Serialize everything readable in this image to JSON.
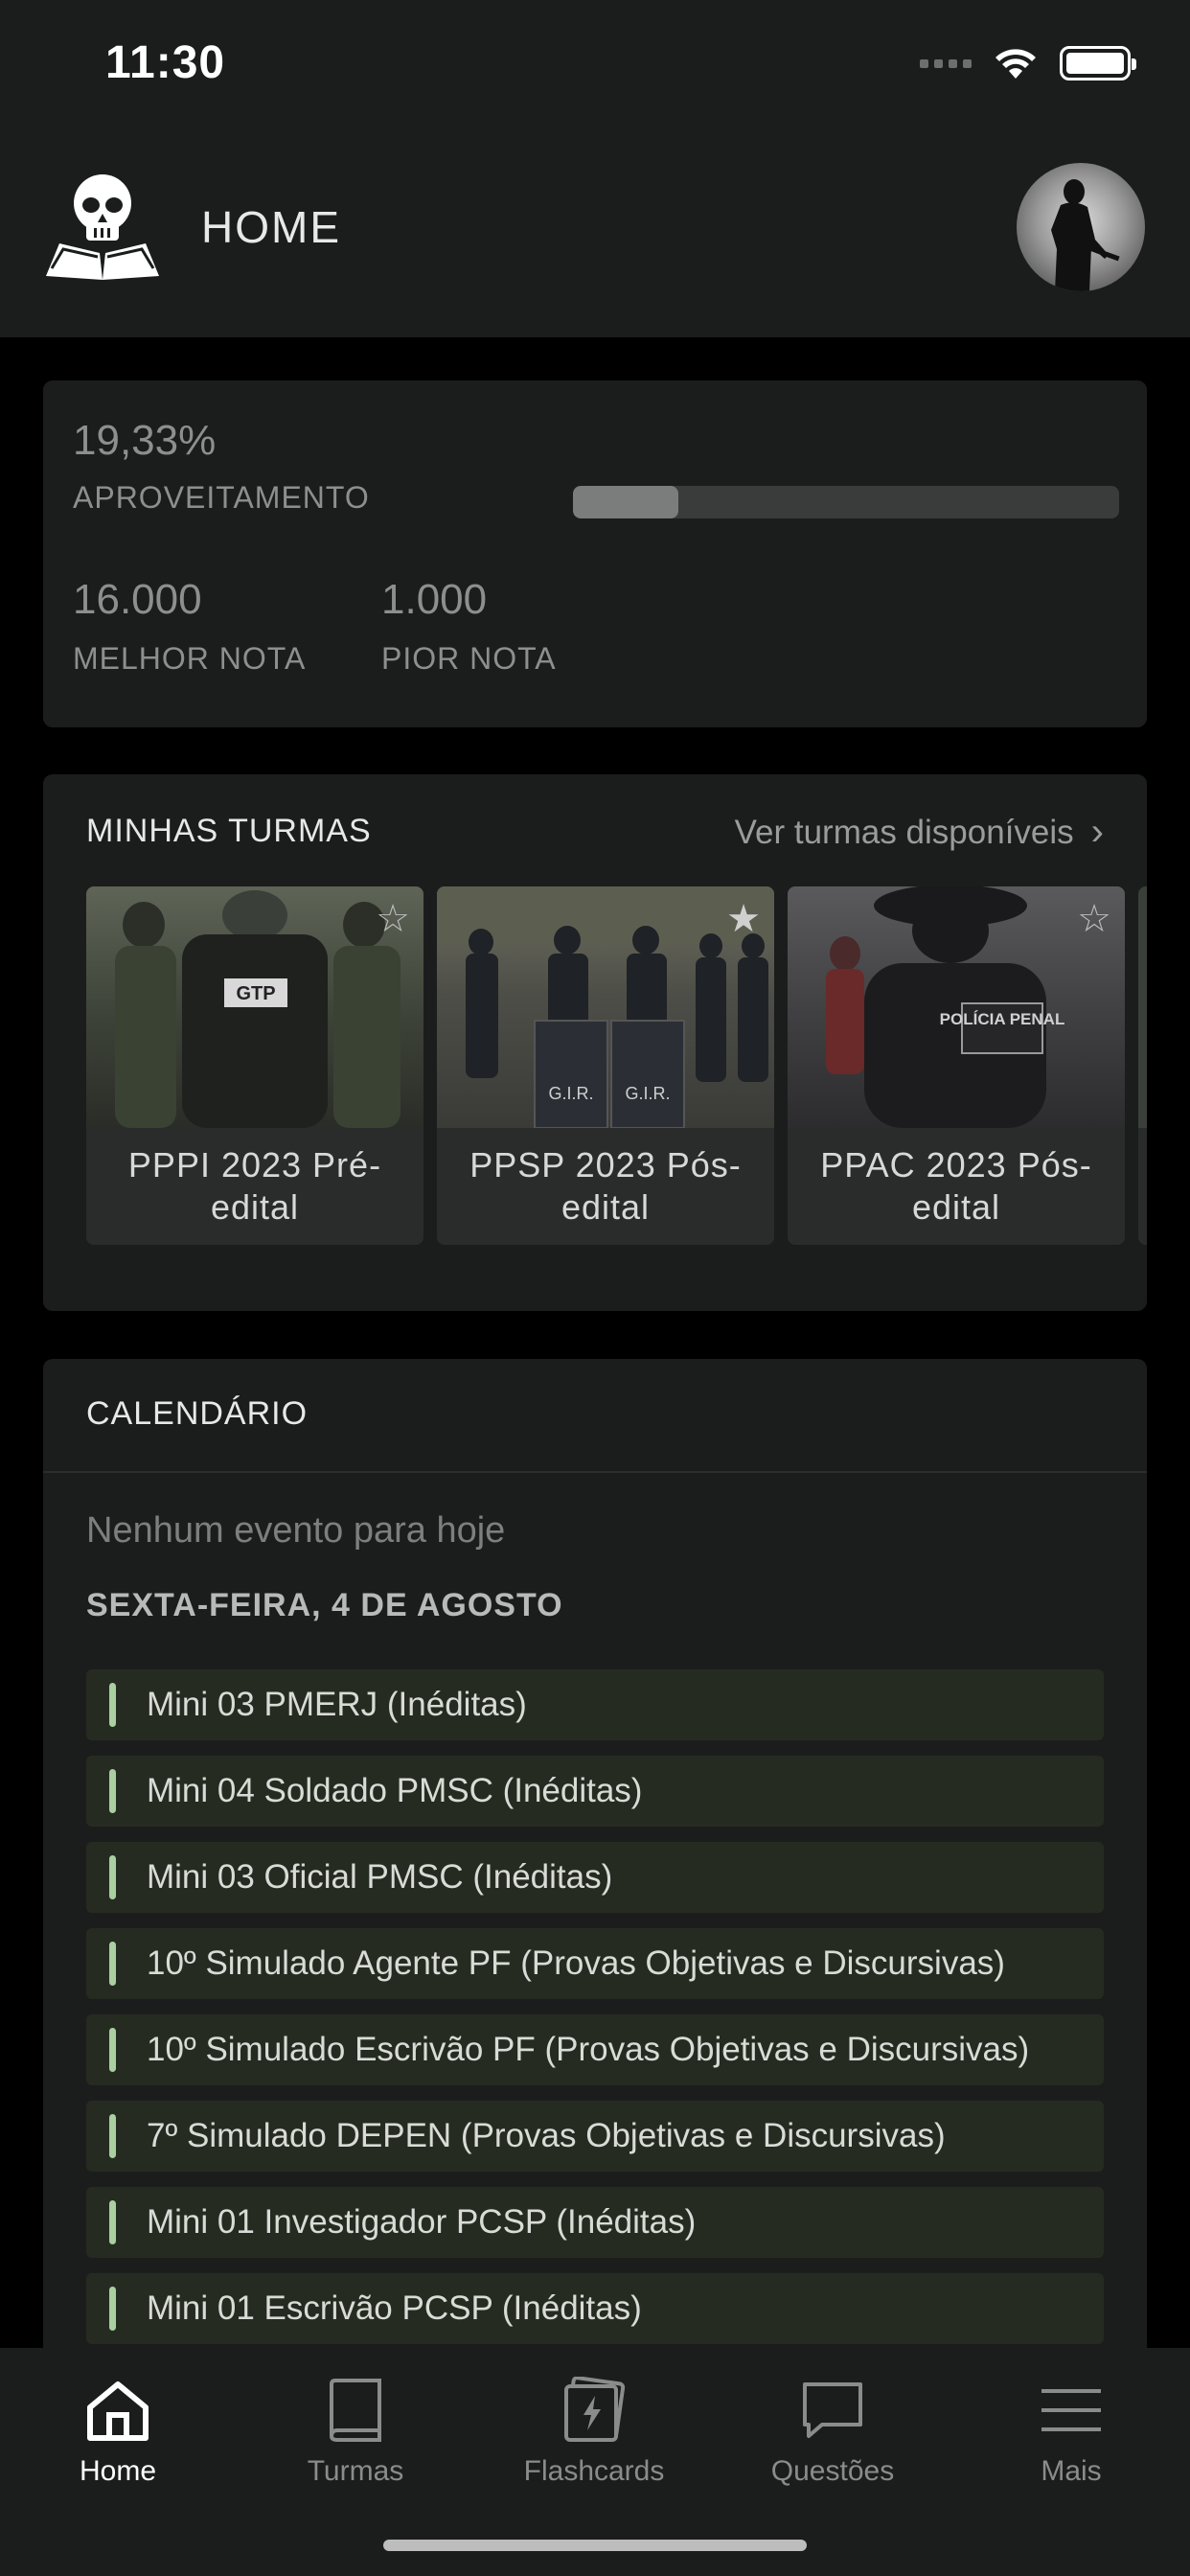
{
  "status_bar": {
    "time": "11:30"
  },
  "header": {
    "title": "HOME"
  },
  "stats": {
    "aproveitamento_value": "19,33%",
    "aproveitamento_label": "APROVEITAMENTO",
    "progress_fraction": 0.1933,
    "melhor_nota_value": "16.000",
    "melhor_nota_label": "MELHOR NOTA",
    "pior_nota_value": "1.000",
    "pior_nota_label": "PIOR NOTA"
  },
  "turmas": {
    "title": "MINHAS TURMAS",
    "link_label": "Ver turmas disponíveis",
    "items": [
      {
        "name": "PPPI 2023 Pré-edital",
        "badge": "GTP",
        "starred": false
      },
      {
        "name": "PPSP 2023 Pós-edital",
        "badge": "G.I.R.",
        "starred": true
      },
      {
        "name": "PPAC 2023 Pós-edital",
        "badge": "POLÍCIA PENAL",
        "starred": false
      }
    ]
  },
  "calendario": {
    "title": "CALENDÁRIO",
    "empty_message": "Nenhum evento para hoje",
    "date_heading": "SEXTA-FEIRA, 4 DE AGOSTO",
    "events": [
      "Mini 03 PMERJ (Inéditas)",
      "Mini 04 Soldado PMSC (Inéditas)",
      "Mini 03 Oficial PMSC (Inéditas)",
      "10º Simulado Agente PF (Provas Objetivas e Discursivas)",
      "10º Simulado Escrivão PF (Provas Objetivas e Discursivas)",
      "7º Simulado DEPEN (Provas Objetivas e Discursivas)",
      "Mini 01 Investigador PCSP (Inéditas)",
      "Mini 01 Escrivão PCSP (Inéditas)"
    ]
  },
  "tabbar": {
    "items": [
      {
        "label": "Home",
        "icon": "home-icon",
        "active": true
      },
      {
        "label": "Turmas",
        "icon": "book-icon",
        "active": false
      },
      {
        "label": "Flashcards",
        "icon": "flashcards-icon",
        "active": false
      },
      {
        "label": "Questões",
        "icon": "chat-bubble-icon",
        "active": false
      },
      {
        "label": "Mais",
        "icon": "menu-icon",
        "active": false
      }
    ]
  },
  "colors": {
    "background": "#000000",
    "surface": "#1b1d1d",
    "event_bg": "#262b22",
    "event_accent": "#aacfa1",
    "muted_text": "#8d8f8f"
  }
}
